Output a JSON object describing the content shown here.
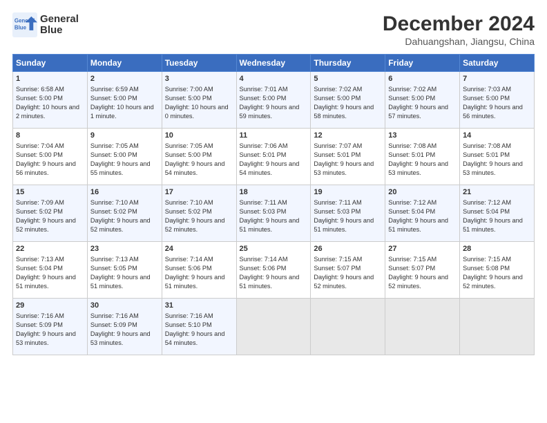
{
  "header": {
    "logo_line1": "General",
    "logo_line2": "Blue",
    "month": "December 2024",
    "location": "Dahuangshan, Jiangsu, China"
  },
  "days_of_week": [
    "Sunday",
    "Monday",
    "Tuesday",
    "Wednesday",
    "Thursday",
    "Friday",
    "Saturday"
  ],
  "weeks": [
    [
      {
        "day": 1,
        "sunrise": "Sunrise: 6:58 AM",
        "sunset": "Sunset: 5:00 PM",
        "daylight": "Daylight: 10 hours and 2 minutes."
      },
      {
        "day": 2,
        "sunrise": "Sunrise: 6:59 AM",
        "sunset": "Sunset: 5:00 PM",
        "daylight": "Daylight: 10 hours and 1 minute."
      },
      {
        "day": 3,
        "sunrise": "Sunrise: 7:00 AM",
        "sunset": "Sunset: 5:00 PM",
        "daylight": "Daylight: 10 hours and 0 minutes."
      },
      {
        "day": 4,
        "sunrise": "Sunrise: 7:01 AM",
        "sunset": "Sunset: 5:00 PM",
        "daylight": "Daylight: 9 hours and 59 minutes."
      },
      {
        "day": 5,
        "sunrise": "Sunrise: 7:02 AM",
        "sunset": "Sunset: 5:00 PM",
        "daylight": "Daylight: 9 hours and 58 minutes."
      },
      {
        "day": 6,
        "sunrise": "Sunrise: 7:02 AM",
        "sunset": "Sunset: 5:00 PM",
        "daylight": "Daylight: 9 hours and 57 minutes."
      },
      {
        "day": 7,
        "sunrise": "Sunrise: 7:03 AM",
        "sunset": "Sunset: 5:00 PM",
        "daylight": "Daylight: 9 hours and 56 minutes."
      }
    ],
    [
      {
        "day": 8,
        "sunrise": "Sunrise: 7:04 AM",
        "sunset": "Sunset: 5:00 PM",
        "daylight": "Daylight: 9 hours and 56 minutes."
      },
      {
        "day": 9,
        "sunrise": "Sunrise: 7:05 AM",
        "sunset": "Sunset: 5:00 PM",
        "daylight": "Daylight: 9 hours and 55 minutes."
      },
      {
        "day": 10,
        "sunrise": "Sunrise: 7:05 AM",
        "sunset": "Sunset: 5:00 PM",
        "daylight": "Daylight: 9 hours and 54 minutes."
      },
      {
        "day": 11,
        "sunrise": "Sunrise: 7:06 AM",
        "sunset": "Sunset: 5:01 PM",
        "daylight": "Daylight: 9 hours and 54 minutes."
      },
      {
        "day": 12,
        "sunrise": "Sunrise: 7:07 AM",
        "sunset": "Sunset: 5:01 PM",
        "daylight": "Daylight: 9 hours and 53 minutes."
      },
      {
        "day": 13,
        "sunrise": "Sunrise: 7:08 AM",
        "sunset": "Sunset: 5:01 PM",
        "daylight": "Daylight: 9 hours and 53 minutes."
      },
      {
        "day": 14,
        "sunrise": "Sunrise: 7:08 AM",
        "sunset": "Sunset: 5:01 PM",
        "daylight": "Daylight: 9 hours and 53 minutes."
      }
    ],
    [
      {
        "day": 15,
        "sunrise": "Sunrise: 7:09 AM",
        "sunset": "Sunset: 5:02 PM",
        "daylight": "Daylight: 9 hours and 52 minutes."
      },
      {
        "day": 16,
        "sunrise": "Sunrise: 7:10 AM",
        "sunset": "Sunset: 5:02 PM",
        "daylight": "Daylight: 9 hours and 52 minutes."
      },
      {
        "day": 17,
        "sunrise": "Sunrise: 7:10 AM",
        "sunset": "Sunset: 5:02 PM",
        "daylight": "Daylight: 9 hours and 52 minutes."
      },
      {
        "day": 18,
        "sunrise": "Sunrise: 7:11 AM",
        "sunset": "Sunset: 5:03 PM",
        "daylight": "Daylight: 9 hours and 51 minutes."
      },
      {
        "day": 19,
        "sunrise": "Sunrise: 7:11 AM",
        "sunset": "Sunset: 5:03 PM",
        "daylight": "Daylight: 9 hours and 51 minutes."
      },
      {
        "day": 20,
        "sunrise": "Sunrise: 7:12 AM",
        "sunset": "Sunset: 5:04 PM",
        "daylight": "Daylight: 9 hours and 51 minutes."
      },
      {
        "day": 21,
        "sunrise": "Sunrise: 7:12 AM",
        "sunset": "Sunset: 5:04 PM",
        "daylight": "Daylight: 9 hours and 51 minutes."
      }
    ],
    [
      {
        "day": 22,
        "sunrise": "Sunrise: 7:13 AM",
        "sunset": "Sunset: 5:04 PM",
        "daylight": "Daylight: 9 hours and 51 minutes."
      },
      {
        "day": 23,
        "sunrise": "Sunrise: 7:13 AM",
        "sunset": "Sunset: 5:05 PM",
        "daylight": "Daylight: 9 hours and 51 minutes."
      },
      {
        "day": 24,
        "sunrise": "Sunrise: 7:14 AM",
        "sunset": "Sunset: 5:06 PM",
        "daylight": "Daylight: 9 hours and 51 minutes."
      },
      {
        "day": 25,
        "sunrise": "Sunrise: 7:14 AM",
        "sunset": "Sunset: 5:06 PM",
        "daylight": "Daylight: 9 hours and 51 minutes."
      },
      {
        "day": 26,
        "sunrise": "Sunrise: 7:15 AM",
        "sunset": "Sunset: 5:07 PM",
        "daylight": "Daylight: 9 hours and 52 minutes."
      },
      {
        "day": 27,
        "sunrise": "Sunrise: 7:15 AM",
        "sunset": "Sunset: 5:07 PM",
        "daylight": "Daylight: 9 hours and 52 minutes."
      },
      {
        "day": 28,
        "sunrise": "Sunrise: 7:15 AM",
        "sunset": "Sunset: 5:08 PM",
        "daylight": "Daylight: 9 hours and 52 minutes."
      }
    ],
    [
      {
        "day": 29,
        "sunrise": "Sunrise: 7:16 AM",
        "sunset": "Sunset: 5:09 PM",
        "daylight": "Daylight: 9 hours and 53 minutes."
      },
      {
        "day": 30,
        "sunrise": "Sunrise: 7:16 AM",
        "sunset": "Sunset: 5:09 PM",
        "daylight": "Daylight: 9 hours and 53 minutes."
      },
      {
        "day": 31,
        "sunrise": "Sunrise: 7:16 AM",
        "sunset": "Sunset: 5:10 PM",
        "daylight": "Daylight: 9 hours and 54 minutes."
      },
      null,
      null,
      null,
      null
    ]
  ]
}
